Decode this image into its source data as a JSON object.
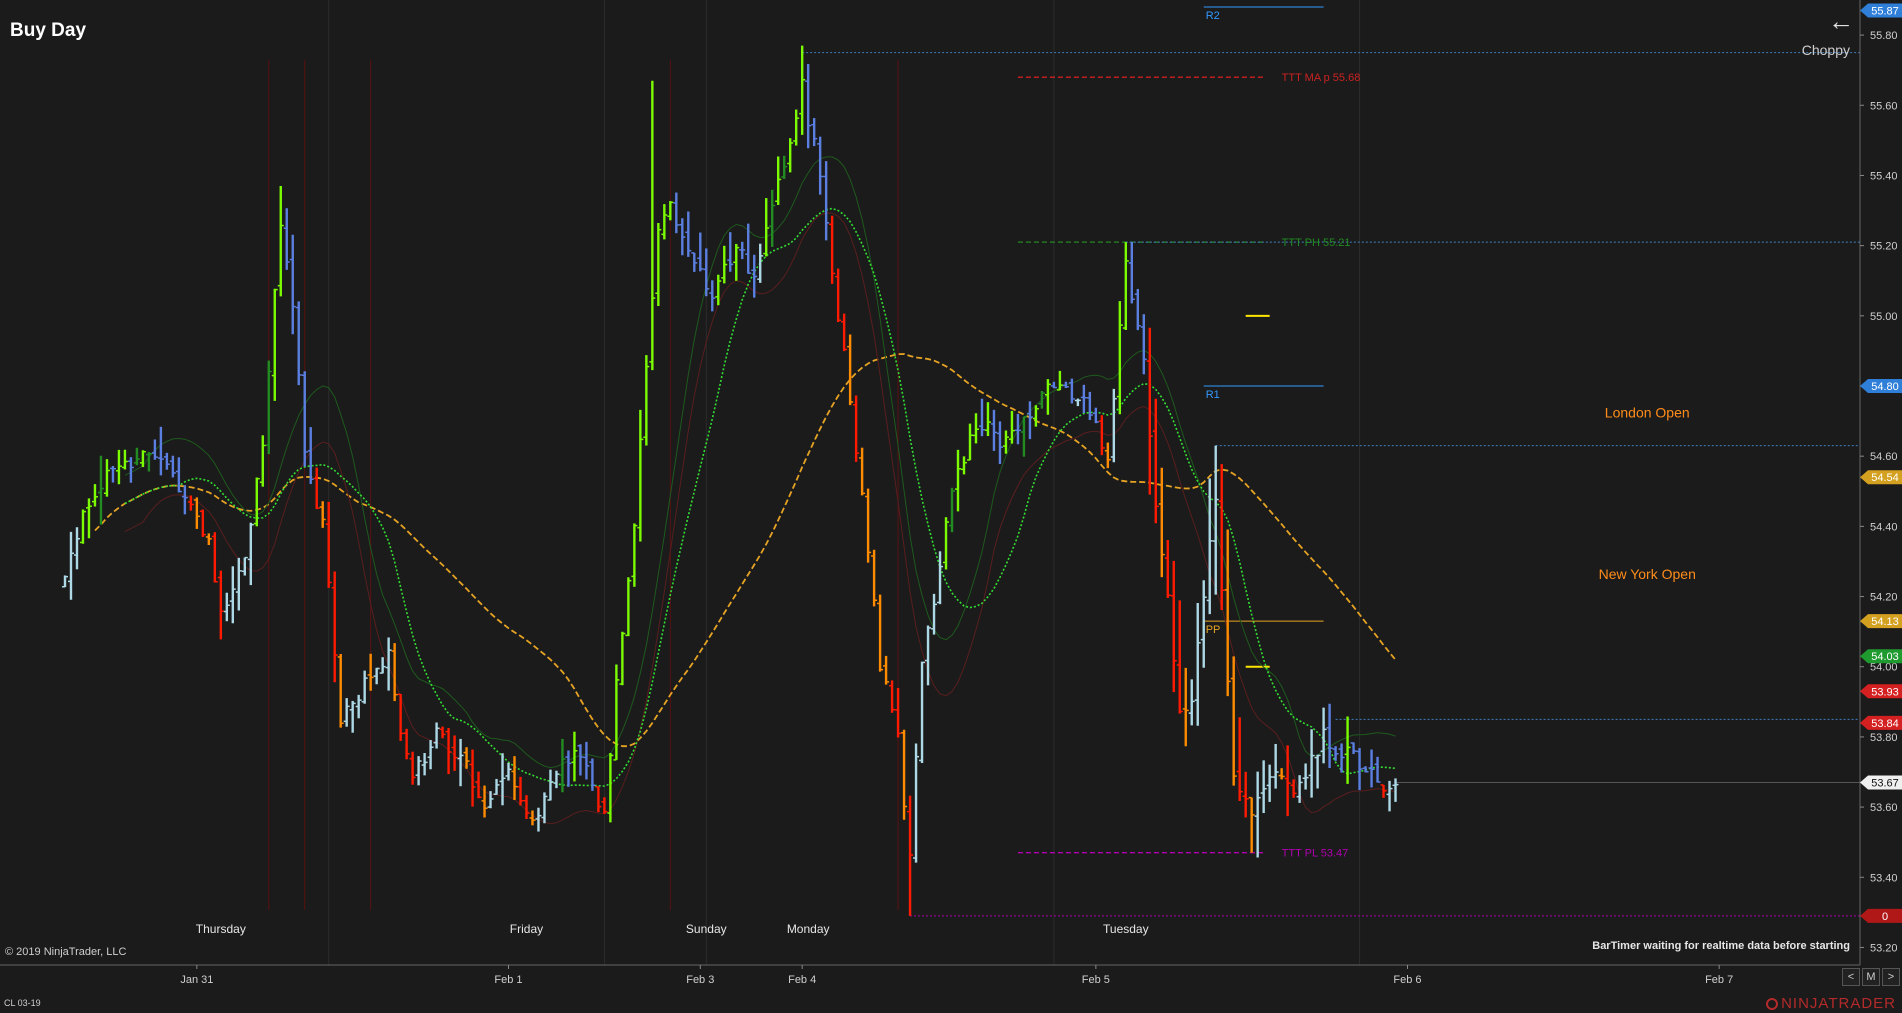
{
  "title": "Buy Day",
  "copyright": "© 2019 NinjaTrader, LLC",
  "instrument": "CL 03-19",
  "bartimer": "BarTimer waiting for realtime data before starting",
  "choppy": "Choppy",
  "nav": {
    "prev": "<",
    "mode": "M",
    "next": ">"
  },
  "logo": "NINJATRADER",
  "colors": {
    "background": "#1b1b1b",
    "up_strong": "#7cfc00",
    "up": "#228b22",
    "down_strong": "#ff1a00",
    "down": "#ff8c00",
    "neutral_up": "#add8e6",
    "neutral_down": "#5b7fe0",
    "ma": "#e6a323"
  },
  "chart_data": {
    "type": "bar",
    "ylim": [
      53.15,
      55.9
    ],
    "y_ticks": [
      "53.20",
      "53.40",
      "53.60",
      "53.80",
      "54.00",
      "54.20",
      "54.40",
      "54.60",
      "54.80",
      "55.00",
      "55.20",
      "55.40",
      "55.60",
      "55.80"
    ],
    "x_ticks": [
      {
        "label": "Jan 31",
        "bar": 22
      },
      {
        "label": "Feb 1",
        "bar": 74
      },
      {
        "label": "Feb 3",
        "bar": 106
      },
      {
        "label": "Feb 4",
        "bar": 123
      },
      {
        "label": "Feb 5",
        "bar": 172
      },
      {
        "label": "Feb 6",
        "bar": 224
      },
      {
        "label": "Feb 7",
        "bar": 276
      }
    ],
    "sessions": [
      {
        "label": "Thursday",
        "bar": 26
      },
      {
        "label": "Friday",
        "bar": 77
      },
      {
        "label": "Sunday",
        "bar": 107
      },
      {
        "label": "Monday",
        "bar": 124
      },
      {
        "label": "Tuesday",
        "bar": 177
      }
    ],
    "pivots": [
      {
        "label": "R2",
        "value": 55.88,
        "color": "#3399ff"
      },
      {
        "label": "R1",
        "value": 54.8,
        "color": "#3399ff"
      },
      {
        "label": "PP",
        "value": 54.13,
        "color": "#e6a323"
      }
    ],
    "ttt_levels": [
      {
        "label": "TTT MA p 55.68",
        "value": 55.68,
        "color": "#cc2222"
      },
      {
        "label": "TTT PH 55.21",
        "value": 55.21,
        "color": "#228b22"
      },
      {
        "label": "TTT PL 53.47",
        "value": 53.47,
        "color": "#b000b0"
      }
    ],
    "session_labels": [
      {
        "label": "London Open",
        "value": 54.71
      },
      {
        "label": "New York Open",
        "value": 54.25
      }
    ],
    "price_markers": [
      {
        "label": "55.87",
        "value": 55.87,
        "color": "#2f7fd8"
      },
      {
        "label": "54.80",
        "value": 54.8,
        "color": "#2f7fd8"
      },
      {
        "label": "54.54",
        "value": 54.54,
        "color": "#d4a020"
      },
      {
        "label": "54.13",
        "value": 54.13,
        "color": "#d4a020"
      },
      {
        "label": "54.03",
        "value": 54.03,
        "color": "#1f9a2f"
      },
      {
        "label": "53.93",
        "value": 53.93,
        "color": "#d42020"
      },
      {
        "label": "53.84",
        "value": 53.84,
        "color": "#d42020"
      },
      {
        "label": "53.67",
        "value": 53.67,
        "color": "#f0f0f0"
      },
      {
        "label": "0",
        "value": 53.29,
        "color": "#b01818"
      }
    ],
    "keyframes": [
      [
        0,
        54.24
      ],
      [
        3,
        54.45
      ],
      [
        8,
        54.56
      ],
      [
        14,
        54.62
      ],
      [
        18,
        54.55
      ],
      [
        22,
        54.42
      ],
      [
        24,
        54.35
      ],
      [
        26,
        54.15
      ],
      [
        28,
        54.22
      ],
      [
        30,
        54.3
      ],
      [
        33,
        54.65
      ],
      [
        36,
        55.25
      ],
      [
        38,
        55.05
      ],
      [
        40,
        54.6
      ],
      [
        43,
        54.4
      ],
      [
        46,
        53.85
      ],
      [
        50,
        53.95
      ],
      [
        54,
        54.05
      ],
      [
        56,
        53.8
      ],
      [
        58,
        53.7
      ],
      [
        62,
        53.8
      ],
      [
        66,
        53.75
      ],
      [
        70,
        53.6
      ],
      [
        74,
        53.72
      ],
      [
        78,
        53.55
      ],
      [
        82,
        53.7
      ],
      [
        86,
        53.75
      ],
      [
        90,
        53.58
      ],
      [
        92,
        53.95
      ],
      [
        95,
        54.4
      ],
      [
        97,
        54.85
      ],
      [
        99,
        55.25
      ],
      [
        101,
        55.3
      ],
      [
        104,
        55.2
      ],
      [
        108,
        55.05
      ],
      [
        112,
        55.2
      ],
      [
        115,
        55.1
      ],
      [
        118,
        55.3
      ],
      [
        121,
        55.5
      ],
      [
        123,
        55.65
      ],
      [
        126,
        55.4
      ],
      [
        128,
        55.1
      ],
      [
        130,
        54.9
      ],
      [
        133,
        54.5
      ],
      [
        136,
        54.0
      ],
      [
        139,
        53.8
      ],
      [
        141,
        53.45
      ],
      [
        143,
        54.0
      ],
      [
        145,
        54.2
      ],
      [
        148,
        54.5
      ],
      [
        152,
        54.7
      ],
      [
        156,
        54.65
      ],
      [
        160,
        54.7
      ],
      [
        165,
        54.8
      ],
      [
        170,
        54.75
      ],
      [
        174,
        54.6
      ],
      [
        177,
        55.15
      ],
      [
        180,
        54.9
      ],
      [
        182,
        54.45
      ],
      [
        184,
        54.2
      ],
      [
        186,
        53.85
      ],
      [
        188,
        53.9
      ],
      [
        190,
        54.2
      ],
      [
        192,
        54.5
      ],
      [
        195,
        53.7
      ],
      [
        198,
        53.6
      ],
      [
        202,
        53.7
      ],
      [
        206,
        53.65
      ],
      [
        210,
        53.8
      ],
      [
        214,
        53.75
      ],
      [
        218,
        53.7
      ],
      [
        222,
        53.64
      ]
    ],
    "bar_count": 223,
    "x_axis_bars": 300
  }
}
